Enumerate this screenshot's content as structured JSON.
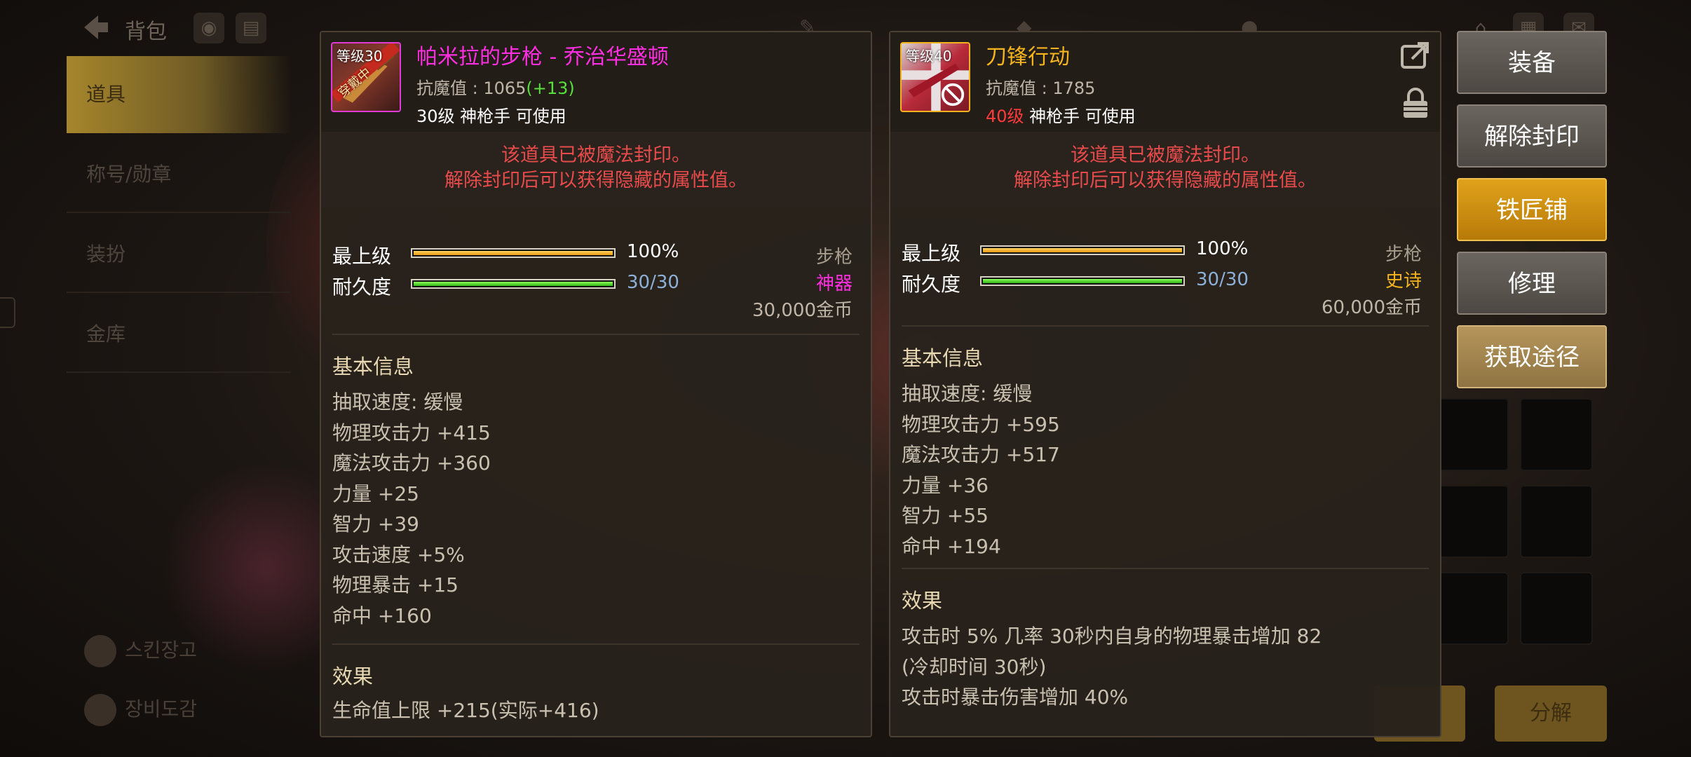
{
  "colors": {
    "legendary_name": "#ff2ee0",
    "epic_name": "#f5b41e",
    "seal_red": "#e84b4b",
    "durability_blue": "#8db0d8",
    "bonus_green": "#56e03c",
    "level_red": "#ff3b3b"
  },
  "topbar": {
    "title": "背包"
  },
  "sidebar": {
    "items": [
      {
        "label": "道具"
      },
      {
        "label": "称号/勋章"
      },
      {
        "label": "装扮"
      },
      {
        "label": "金库"
      }
    ],
    "bottom_items": [
      {
        "label": "스킨장고"
      },
      {
        "label": "장비도감"
      }
    ]
  },
  "bottom_right": {
    "btn2": "分解"
  },
  "left_panel": {
    "icon_badge": "等级30",
    "icon_ribbon": "穿戴中",
    "name": "帕米拉的步枪 - 乔治华盛顿",
    "magic_resist_label": "抗魔值 : 1065",
    "magic_resist_bonus": "(+13)",
    "level_req": "30级",
    "level_req_rest": " 神枪手 可使用",
    "seal_line1": "该道具已被魔法封印。",
    "seal_line2": "解除封印后可以获得隐藏的属性值。",
    "grade_label": "最上级",
    "grade_value": "100%",
    "grade_percent": 100,
    "durability_label": "耐久度",
    "durability_value": "30/30",
    "durability_percent": 100,
    "weapon_type": "步枪",
    "rarity": "神器",
    "price": "30,000金币",
    "basic_info_title": "基本信息",
    "stats": [
      "抽取速度:  缓慢",
      "物理攻击力 +415",
      "魔法攻击力 +360",
      "力量 +25",
      "智力 +39",
      "攻击速度 +5%",
      "物理暴击 +15",
      "命中 +160"
    ],
    "effect_title": "效果",
    "effect_partial": "生命值上限 +215(实际+416)"
  },
  "right_panel": {
    "icon_badge": "等级40",
    "name": "刀锋行动",
    "magic_resist_label": "抗魔值 : 1785",
    "level_req": "40级",
    "level_req_rest": " 神枪手 可使用",
    "seal_line1": "该道具已被魔法封印。",
    "seal_line2": "解除封印后可以获得隐藏的属性值。",
    "grade_label": "最上级",
    "grade_value": "100%",
    "grade_percent": 100,
    "durability_label": "耐久度",
    "durability_value": "30/30",
    "durability_percent": 100,
    "weapon_type": "步枪",
    "rarity": "史诗",
    "price": "60,000金币",
    "basic_info_title": "基本信息",
    "stats": [
      "抽取速度:  缓慢",
      "物理攻击力 +595",
      "魔法攻击力 +517",
      "力量 +36",
      "智力 +55",
      "命中 +194"
    ],
    "effect_title": "效果",
    "effects": [
      "攻击时 5% 几率 30秒内自身的物理暴击增加 82",
      "(冷却时间 30秒)",
      "攻击时暴击伤害增加 40%"
    ]
  },
  "actions": {
    "equip": "装备",
    "unseal": "解除封印",
    "blacksmith": "铁匠铺",
    "repair": "修理",
    "obtain": "获取途径"
  }
}
